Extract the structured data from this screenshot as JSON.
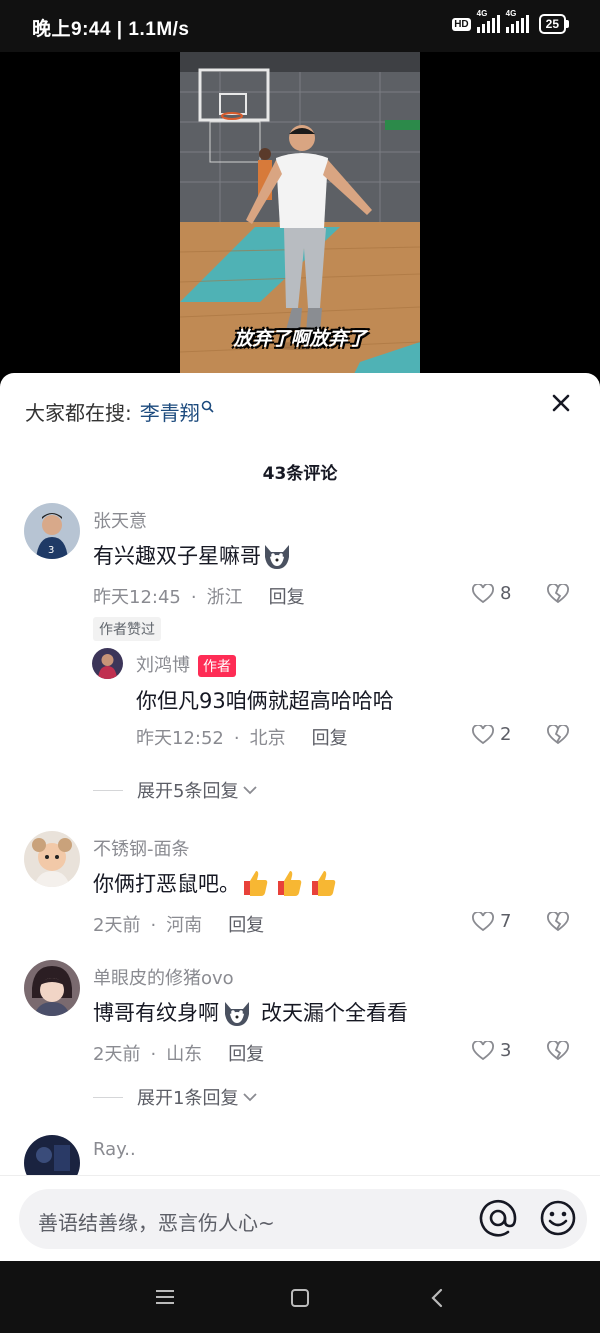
{
  "status_bar": {
    "time": "晚上9:44 | 1.1M/s",
    "hd": "HD",
    "network1": "4G",
    "network2": "4G",
    "battery": "25"
  },
  "video": {
    "caption": "放弃了啊放弃了"
  },
  "search_hint": {
    "prefix": "大家都在搜:",
    "keyword": "李青翔"
  },
  "comment_count": "43条评论",
  "comments": [
    {
      "name": "张天意",
      "text": "有兴趣双子星嘛哥",
      "time": "昨天12:45",
      "location": "浙江",
      "reply_label": "回复",
      "likes": "8",
      "author_liked": "作者赞过",
      "replies": [
        {
          "name": "刘鸿博",
          "author_tag": "作者",
          "text": "你但凡93咱俩就超高哈哈哈",
          "time": "昨天12:52",
          "location": "北京",
          "reply_label": "回复",
          "likes": "2"
        }
      ],
      "expand_label": "展开5条回复"
    },
    {
      "name": "不锈钢-面条",
      "text": "你俩打恶鼠吧。",
      "time": "2天前",
      "location": "河南",
      "reply_label": "回复",
      "likes": "7"
    },
    {
      "name": "单眼皮的修猪ovo",
      "text_before": "博哥有纹身啊",
      "text_after": "改天漏个全看看",
      "time": "2天前",
      "location": "山东",
      "reply_label": "回复",
      "likes": "3",
      "expand_label": "展开1条回复"
    },
    {
      "name": "Ray.."
    }
  ],
  "input": {
    "placeholder": "善语结善缘，恶言伤人心~"
  },
  "icons": {
    "close": "close-icon",
    "like": "heart-outline-icon",
    "dislike": "broken-heart-icon",
    "at": "at-mention-icon",
    "emoji": "smiley-icon",
    "search": "search-icon"
  },
  "colors": {
    "author_tag": "#fe2c55",
    "keyword": "#1d4b7e"
  }
}
